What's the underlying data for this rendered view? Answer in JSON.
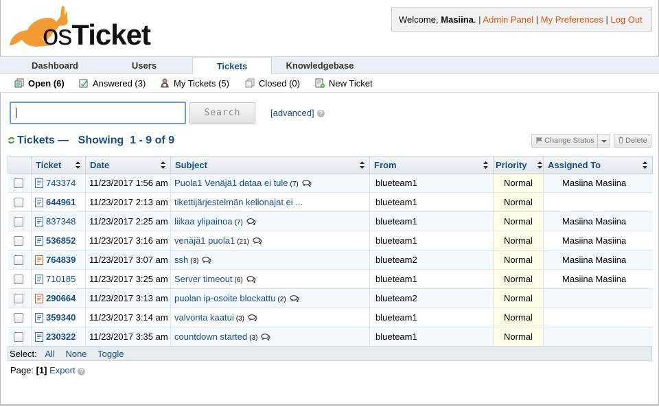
{
  "header": {
    "logo_text": "osTicket",
    "welcome_prefix": "Welcome,",
    "username": "Masiina",
    "welcome_suffix": ".",
    "links": [
      "Admin Panel",
      "My Preferences",
      "Log Out"
    ]
  },
  "nav": {
    "tabs": [
      {
        "label": "Dashboard",
        "active": false
      },
      {
        "label": "Users",
        "active": false
      },
      {
        "label": "Tickets",
        "active": true
      },
      {
        "label": "Knowledgebase",
        "active": false
      }
    ]
  },
  "subnav": {
    "items": [
      {
        "label": "Open (6)",
        "icon": "open-tickets-icon",
        "active": true
      },
      {
        "label": "Answered (3)",
        "icon": "answered-tickets-icon",
        "active": false
      },
      {
        "label": "My Tickets (5)",
        "icon": "my-tickets-icon",
        "active": false
      },
      {
        "label": "Closed (0)",
        "icon": "closed-tickets-icon",
        "active": false
      },
      {
        "label": "New Ticket",
        "icon": "new-ticket-icon",
        "active": false
      }
    ]
  },
  "search": {
    "value": "",
    "button_label": "Search",
    "advanced_label": "[advanced]"
  },
  "list": {
    "title": "Tickets — Showing 1 - 9 of 9",
    "title_prefix": "Tickets —",
    "title_range": "Showing  1 - 9 of 9",
    "change_status_label": "Change Status",
    "delete_label": "Delete"
  },
  "table": {
    "columns": [
      "Ticket",
      "Date",
      "Subject",
      "From",
      "Priority",
      "Assigned To"
    ],
    "rows": [
      {
        "ticket": "743374",
        "bold": false,
        "icon": "ticket-icon",
        "date": "11/23/2017 1:56 am",
        "subject": "Puola1 Venäjä1 dataa ei tule",
        "count": "(7)",
        "thread": true,
        "from": "blueteam1",
        "priority": "Normal",
        "assigned": "Masiina Masiina"
      },
      {
        "ticket": "644961",
        "bold": true,
        "icon": "ticket-icon",
        "date": "11/23/2017 2:13 am",
        "subject": "tikettijärjestelmän kellonajat ei ...",
        "count": "",
        "thread": false,
        "from": "blueteam1",
        "priority": "Normal",
        "assigned": ""
      },
      {
        "ticket": "837348",
        "bold": false,
        "icon": "ticket-icon",
        "date": "11/23/2017 2:25 am",
        "subject": "liikaa ylipainoa",
        "count": "(7)",
        "thread": true,
        "from": "blueteam1",
        "priority": "Normal",
        "assigned": "Masiina Masiina"
      },
      {
        "ticket": "536852",
        "bold": true,
        "icon": "ticket-icon",
        "date": "11/23/2017 3:16 am",
        "subject": "venäjä1 puola1",
        "count": "(21)",
        "thread": true,
        "from": "blueteam1",
        "priority": "Normal",
        "assigned": "Masiina Masiina"
      },
      {
        "ticket": "764839",
        "bold": true,
        "icon": "overdue-ticket-icon",
        "date": "11/23/2017 3:07 am",
        "subject": "ssh",
        "count": "(3)",
        "thread": true,
        "from": "blueteam2",
        "priority": "Normal",
        "assigned": "Masiina Masiina"
      },
      {
        "ticket": "710185",
        "bold": false,
        "icon": "ticket-icon",
        "date": "11/23/2017 3:25 am",
        "subject": "Server timeout",
        "count": "(6)",
        "thread": true,
        "from": "blueteam1",
        "priority": "Normal",
        "assigned": "Masiina Masiina"
      },
      {
        "ticket": "290664",
        "bold": true,
        "icon": "overdue-ticket-icon",
        "date": "11/23/2017 3:13 am",
        "subject": "puolan ip-osoite blockattu",
        "count": "(2)",
        "thread": true,
        "from": "blueteam2",
        "priority": "Normal",
        "assigned": ""
      },
      {
        "ticket": "359340",
        "bold": true,
        "icon": "ticket-icon",
        "date": "11/23/2017 3:14 am",
        "subject": "valvonta kaatui",
        "count": "(3)",
        "thread": true,
        "from": "blueteam1",
        "priority": "Normal",
        "assigned": ""
      },
      {
        "ticket": "230322",
        "bold": true,
        "icon": "ticket-icon",
        "date": "11/23/2017 3:35 am",
        "subject": "countdown started",
        "count": "(3)",
        "thread": true,
        "from": "blueteam1",
        "priority": "Normal",
        "assigned": ""
      }
    ]
  },
  "select": {
    "label": "Select:",
    "options": [
      "All",
      "None",
      "Toggle"
    ]
  },
  "pager": {
    "label": "Page:",
    "current": "[1]",
    "export_label": "Export"
  },
  "colors": {
    "link": "#184E81",
    "header_link": "#E2530F",
    "logo_orange": "#F39C34",
    "row_alt": "#f2f8fc",
    "priority_bg": "#fdfde8"
  }
}
